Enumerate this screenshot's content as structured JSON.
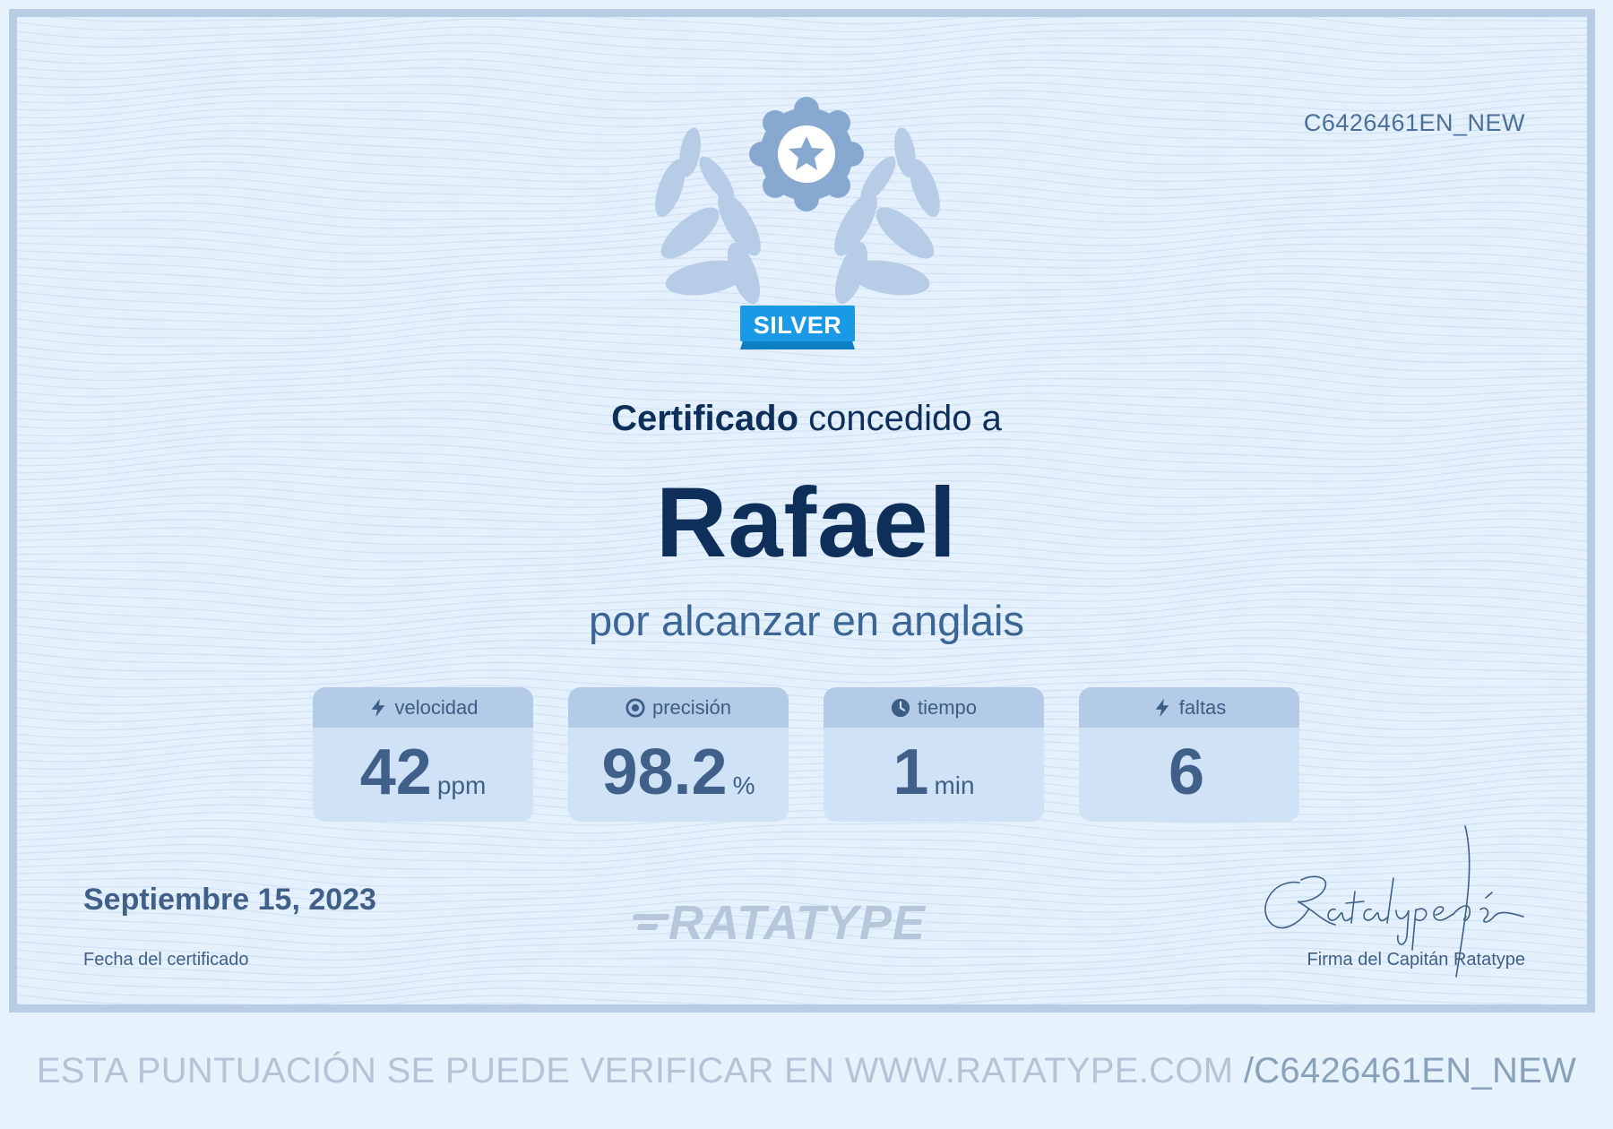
{
  "certificate": {
    "code": "C6426461EN_NEW",
    "badge_label": "SILVER",
    "headline_bold": "Certificado",
    "headline_rest": "concedido a",
    "recipient": "Rafael",
    "subline": "por alcanzar en anglais"
  },
  "stats": [
    {
      "label": "velocidad",
      "value": "42",
      "unit": "ppm",
      "icon": "lightning-icon"
    },
    {
      "label": "precisión",
      "value": "98.2",
      "unit": "%",
      "icon": "target-icon"
    },
    {
      "label": "tiempo",
      "value": "1",
      "unit": "min",
      "icon": "clock-icon"
    },
    {
      "label": "faltas",
      "value": "6",
      "unit": "",
      "icon": "lightning-icon"
    }
  ],
  "footer": {
    "date": "Septiembre 15, 2023",
    "date_label": "Fecha del certificado",
    "brand": "RATATYPE",
    "signature_label": "Firma del Capitán Ratatype"
  },
  "verify": {
    "text": "ESTA PUNTUACIÓN SE PUEDE VERIFICAR EN WWW.RATATYPE.COM",
    "code": "/C6426461EN_NEW"
  },
  "colors": {
    "background": "#e4f1fc",
    "border": "#b8cce4",
    "navy": "#0d2f5a",
    "badge_ribbon": "#1a9ae6",
    "laurel": "#b3c9e4",
    "medal": "#87a9d0"
  }
}
